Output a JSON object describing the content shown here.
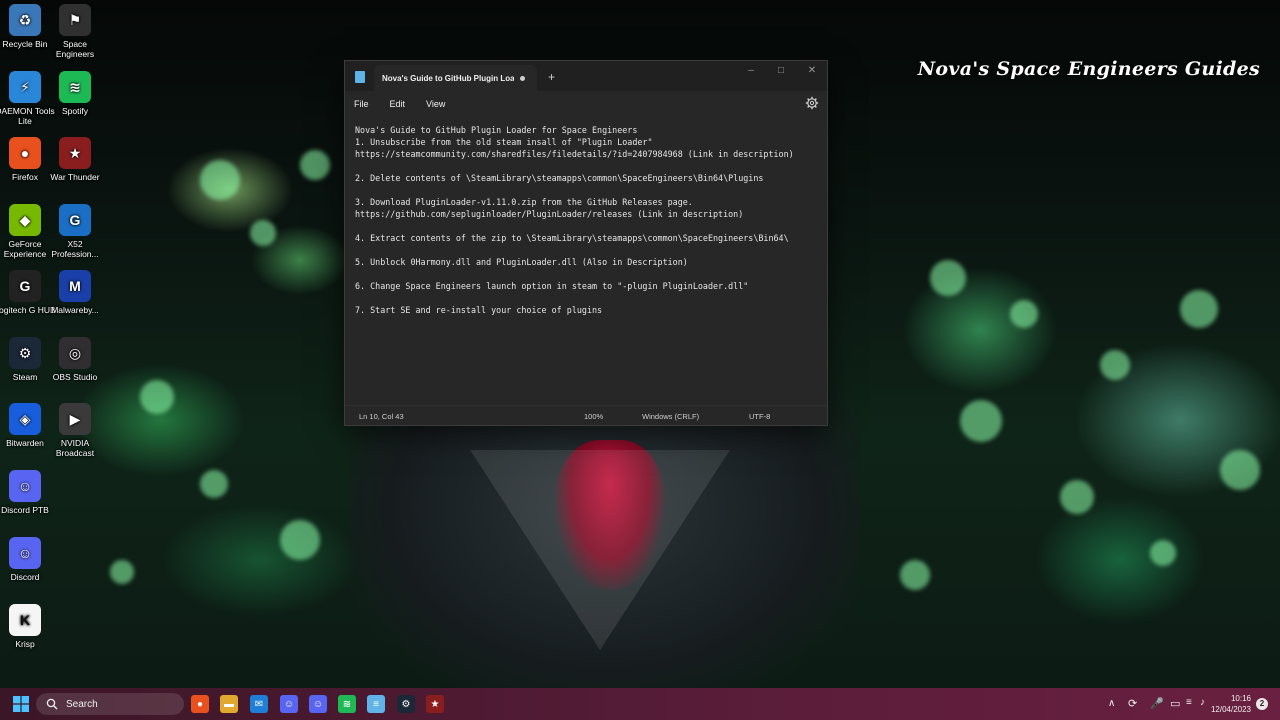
{
  "wallpaper": {
    "title": "Nova's Space Engineers Guides"
  },
  "desktop_icons": [
    {
      "label": "Recycle Bin",
      "icon": "recycle-bin-icon",
      "color": "#3a77b8"
    },
    {
      "label": "Space Engineers",
      "icon": "space-engineers-icon",
      "color": "#303030"
    },
    {
      "label": "DAEMON Tools Lite",
      "icon": "daemon-tools-icon",
      "color": "#2a86d8"
    },
    {
      "label": "Spotify",
      "icon": "spotify-icon",
      "color": "#1db954"
    },
    {
      "label": "Firefox",
      "icon": "firefox-icon",
      "color": "#e8501e"
    },
    {
      "label": "War Thunder",
      "icon": "war-thunder-icon",
      "color": "#8a1e1e"
    },
    {
      "label": "GeForce Experience",
      "icon": "geforce-icon",
      "color": "#76b900"
    },
    {
      "label": "X52 Profession...",
      "icon": "logitech-g-icon",
      "color": "#1a6fc4"
    },
    {
      "label": "Logitech G HUB",
      "icon": "logitech-ghub-icon",
      "color": "#222222"
    },
    {
      "label": "Malwareby...",
      "icon": "malwarebytes-icon",
      "color": "#1b3fa8"
    },
    {
      "label": "Steam",
      "icon": "steam-icon",
      "color": "#1b2838"
    },
    {
      "label": "OBS Studio",
      "icon": "obs-icon",
      "color": "#302e31"
    },
    {
      "label": "Bitwarden",
      "icon": "bitwarden-icon",
      "color": "#175ddc"
    },
    {
      "label": "NVIDIA Broadcast",
      "icon": "nvidia-broadcast-icon",
      "color": "#3a3a3a"
    },
    {
      "label": "Discord PTB",
      "icon": "discord-ptb-icon",
      "color": "#5865f2"
    },
    {
      "label": "Discord",
      "icon": "discord-icon",
      "color": "#5865f2"
    },
    {
      "label": "Krisp",
      "icon": "krisp-icon",
      "color": "#f5f5f5"
    }
  ],
  "notepad": {
    "tab_title": "Nova's Guide to GitHub Plugin Loader",
    "new_tab": "+",
    "menu": [
      "File",
      "Edit",
      "View"
    ],
    "lines": [
      "Nova's Guide to GitHub Plugin Loader for Space Engineers",
      "1. Unsubscribe from the old steam insall of \"Plugin Loader\"",
      "https://steamcommunity.com/sharedfiles/filedetails/?id=2407984968 (Link in description)",
      "",
      "2. Delete contents of \\SteamLibrary\\steamapps\\common\\SpaceEngineers\\Bin64\\Plugins",
      "",
      "3. Download PluginLoader-v1.11.0.zip from the GitHub Releases page.",
      "https://github.com/sepluginloader/PluginLoader/releases (Link in description)",
      "",
      "4. Extract contents of the zip to \\SteamLibrary\\steamapps\\common\\SpaceEngineers\\Bin64\\",
      "",
      "5. Unblock 0Harmony.dll and PluginLoader.dll (Also in Description)",
      "",
      "6. Change Space Engineers launch option in steam to \"-plugin PluginLoader.dll\"",
      "",
      "7. Start SE and re-install your choice of plugins"
    ],
    "status": {
      "position": "Ln 10, Col 43",
      "zoom": "100%",
      "line_ending": "Windows (CRLF)",
      "encoding": "UTF-8"
    }
  },
  "taskbar": {
    "search_label": "Search",
    "apps": [
      {
        "icon": "firefox-icon",
        "color": "#e8501e"
      },
      {
        "icon": "file-explorer-icon",
        "color": "#e0a82e"
      },
      {
        "icon": "mail-icon",
        "color": "#1e7fd8"
      },
      {
        "icon": "discord-ptb-icon",
        "color": "#5865f2"
      },
      {
        "icon": "discord-icon",
        "color": "#5865f2"
      },
      {
        "icon": "spotify-icon",
        "color": "#1db954"
      },
      {
        "icon": "notepad-icon",
        "color": "#5fb3e8"
      },
      {
        "icon": "steam-icon",
        "color": "#1b2838"
      },
      {
        "icon": "war-thunder-icon",
        "color": "#8a1e1e"
      }
    ],
    "clock_time": "10:16",
    "clock_date": "12/04/2023",
    "notification_count": "2"
  }
}
